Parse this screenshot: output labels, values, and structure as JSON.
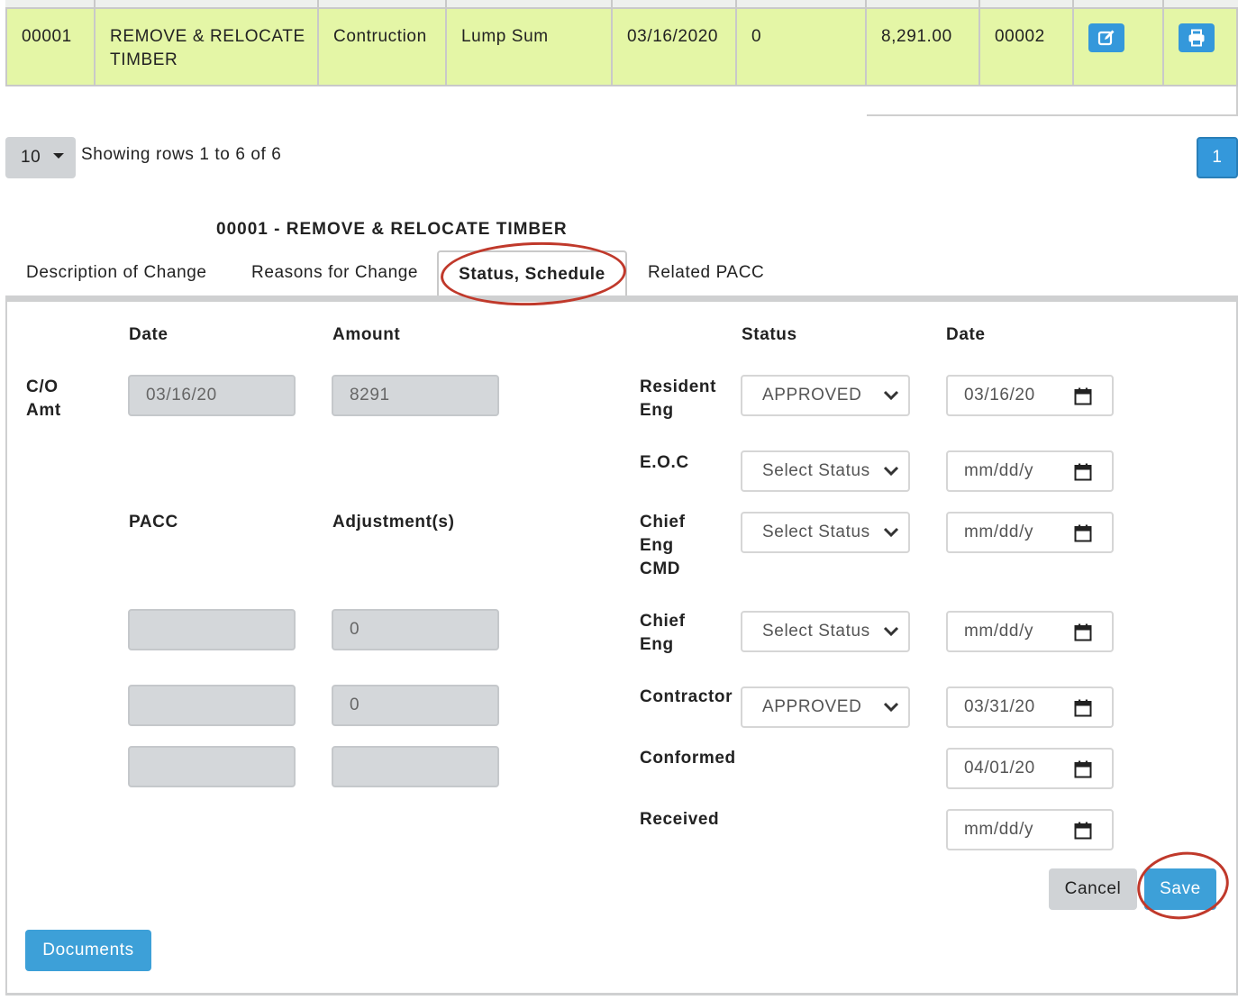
{
  "row": {
    "number": "00001",
    "description": "REMOVE & RELOCATE TIMBER",
    "type": "Contruction",
    "basis": "Lump Sum",
    "date": "03/16/2020",
    "days": "0",
    "amount": "8,291.00",
    "ref": "00002",
    "edit_icon": "edit-icon",
    "print_icon": "print-icon"
  },
  "pagination": {
    "page_size": "10",
    "showing": "Showing rows 1 to 6 of 6",
    "current_page": "1"
  },
  "detail": {
    "title": "00001 - REMOVE & RELOCATE TIMBER",
    "tabs": [
      "Description of Change",
      "Reasons for Change",
      "Status, Schedule",
      "Related PACC"
    ],
    "active_tab": "Status, Schedule"
  },
  "left": {
    "col_date": "Date",
    "col_amount": "Amount",
    "co_amt_label": "C/O\nAmt",
    "co_date": "03/16/20",
    "co_amount": "8291",
    "col_pacc": "PACC",
    "col_adjust": "Adjustment(s)",
    "pacc_rows": [
      {
        "pacc": "",
        "adjustment": "0"
      },
      {
        "pacc": "",
        "adjustment": "0"
      },
      {
        "pacc": "",
        "adjustment": ""
      }
    ]
  },
  "right": {
    "col_status": "Status",
    "col_date": "Date",
    "rows": [
      {
        "label": "Resident\nEng",
        "status": "APPROVED",
        "date": "03/16/20"
      },
      {
        "label": "E.O.C",
        "status": "Select Status",
        "date": "mm/dd/y"
      },
      {
        "label": "Chief\nEng\nCMD",
        "status": "Select Status",
        "date": "mm/dd/y"
      },
      {
        "label": "Chief\nEng",
        "status": "Select Status",
        "date": "mm/dd/y"
      },
      {
        "label": "Contractor",
        "status": "APPROVED",
        "date": "03/31/20"
      },
      {
        "label": "Conformed",
        "date": "04/01/20"
      },
      {
        "label": "Received",
        "date": "mm/dd/y"
      }
    ]
  },
  "buttons": {
    "cancel": "Cancel",
    "save": "Save",
    "documents": "Documents"
  },
  "colors": {
    "row_highlight": "#e4f6a6",
    "primary": "#3498db",
    "annotation": "#c0392b"
  }
}
